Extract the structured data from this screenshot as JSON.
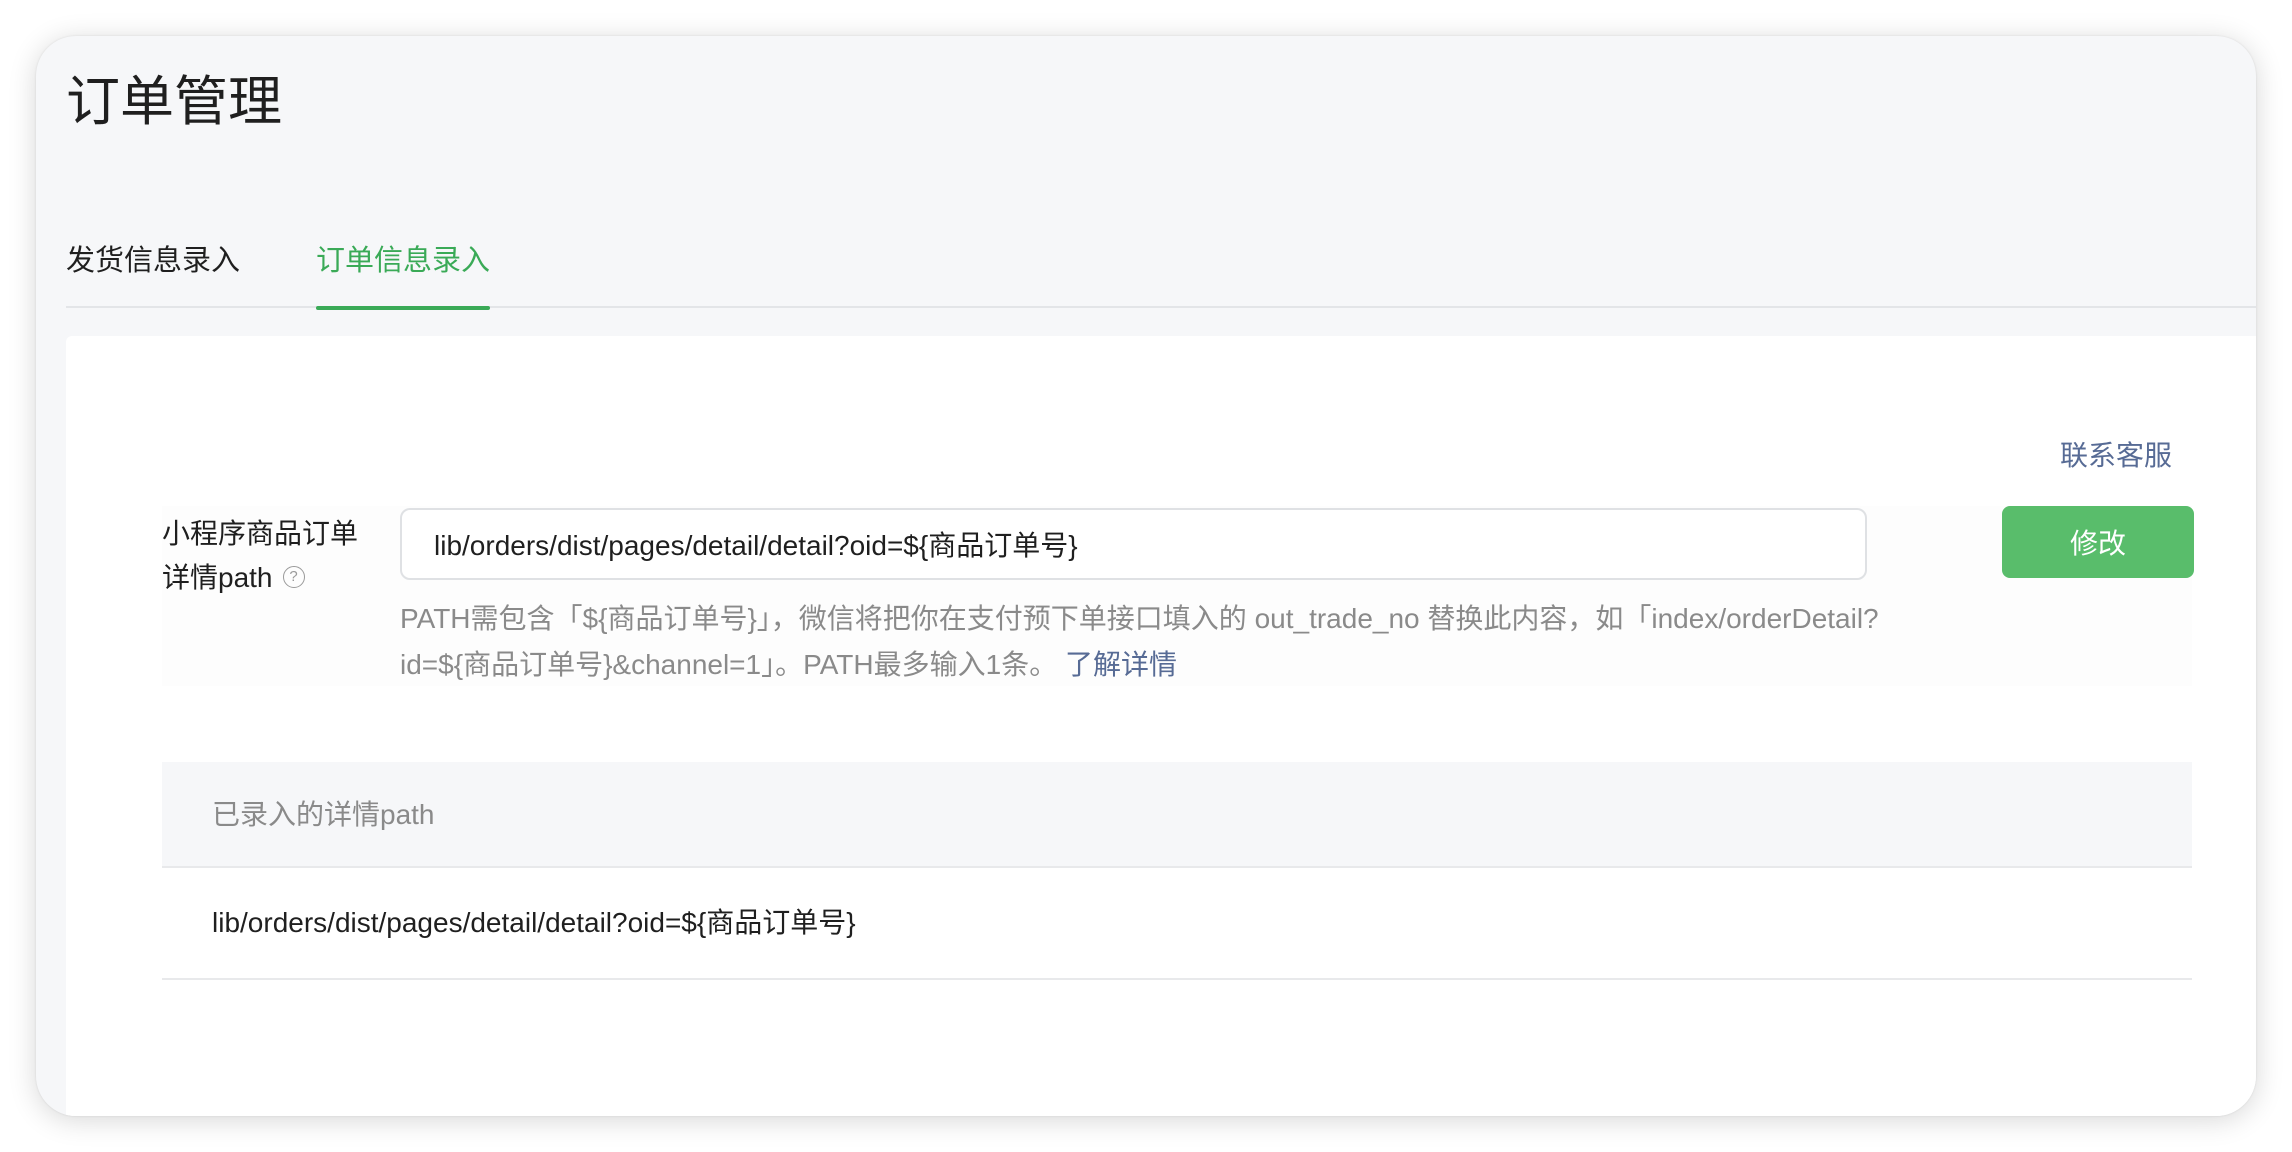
{
  "page": {
    "title": "订单管理"
  },
  "tabs": [
    {
      "label": "发货信息录入",
      "active": false
    },
    {
      "label": "订单信息录入",
      "active": true
    }
  ],
  "card": {
    "contact_label": "联系客服",
    "form": {
      "label_line1": "小程序商品订单",
      "label_line2": "详情path",
      "help_icon": "?",
      "input_value": "lib/orders/dist/pages/detail/detail?oid=${商品订单号}",
      "submit_label": "修改",
      "hint_text": "PATH需包含「${商品订单号}」，微信将把你在支付预下单接口填入的 out_trade_no 替换此内容，如「index/orderDetail?id=${商品订单号}&channel=1」。PATH最多输入1条。",
      "learn_more_label": "了解详情"
    },
    "list": {
      "header": "已录入的详情path",
      "rows": [
        {
          "path": "lib/orders/dist/pages/detail/detail?oid=${商品订单号}"
        }
      ]
    }
  },
  "colors": {
    "accent": "#3aaa57",
    "button": "#59bd6b",
    "link": "#576b95"
  }
}
